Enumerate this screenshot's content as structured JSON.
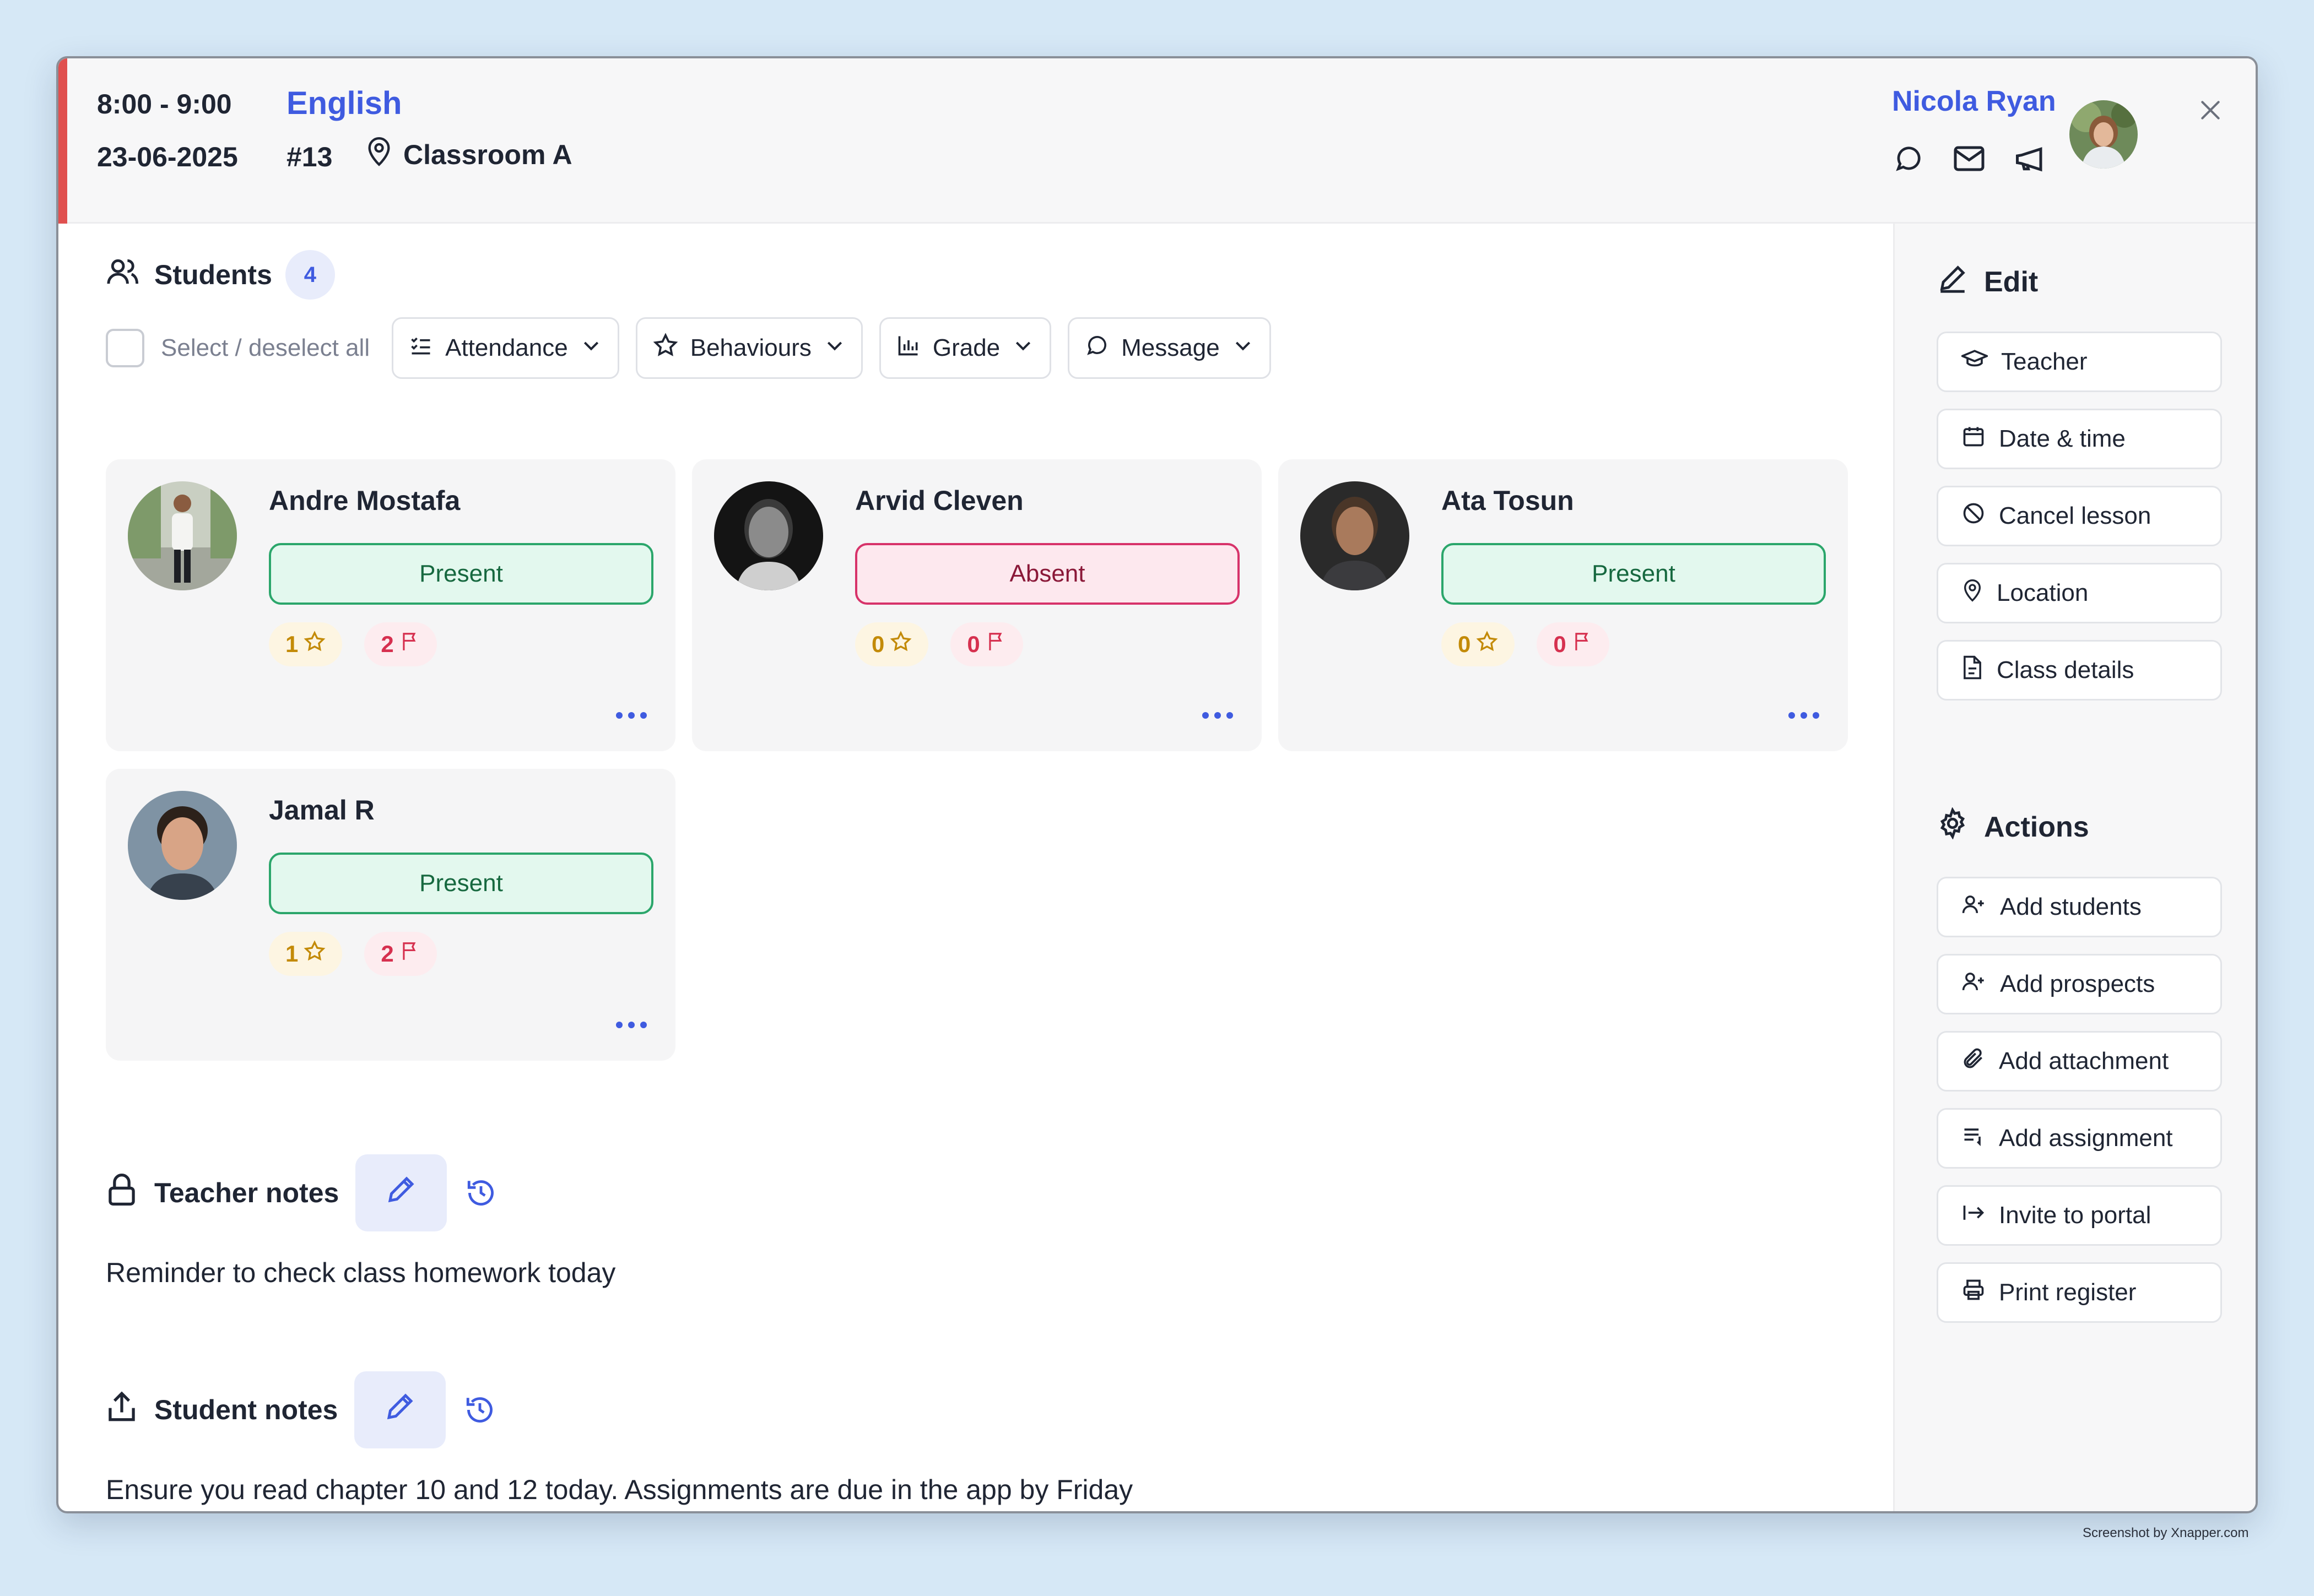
{
  "header": {
    "time": "8:00 - 9:00",
    "date": "23-06-2025",
    "subject": "English",
    "lesson_number": "#13",
    "location": "Classroom A",
    "teacher": "Nicola Ryan",
    "accent_color": "#e0504f"
  },
  "students": {
    "title": "Students",
    "count": "4",
    "select_all": "Select / deselect all",
    "filters": [
      "Attendance",
      "Behaviours",
      "Grade",
      "Message"
    ],
    "list": [
      {
        "name": "Andre Mostafa",
        "status": "Present",
        "stars": "1",
        "flags": "2"
      },
      {
        "name": "Arvid Cleven",
        "status": "Absent",
        "stars": "0",
        "flags": "0"
      },
      {
        "name": "Ata Tosun",
        "status": "Present",
        "stars": "0",
        "flags": "0"
      },
      {
        "name": "Jamal R",
        "status": "Present",
        "stars": "1",
        "flags": "2"
      }
    ]
  },
  "teacher_notes": {
    "title": "Teacher notes",
    "text": "Reminder to check class homework today"
  },
  "student_notes": {
    "title": "Student notes",
    "text": "Ensure you read chapter 10 and 12 today. Assignments are due in the app by Friday"
  },
  "sidebar": {
    "edit_title": "Edit",
    "edit_items": [
      "Teacher",
      "Date & time",
      "Cancel lesson",
      "Location",
      "Class details"
    ],
    "actions_title": "Actions",
    "action_items": [
      "Add students",
      "Add prospects",
      "Add attachment",
      "Add assignment",
      "Invite to portal",
      "Print register"
    ]
  },
  "watermark": "Screenshot by Xnapper.com"
}
